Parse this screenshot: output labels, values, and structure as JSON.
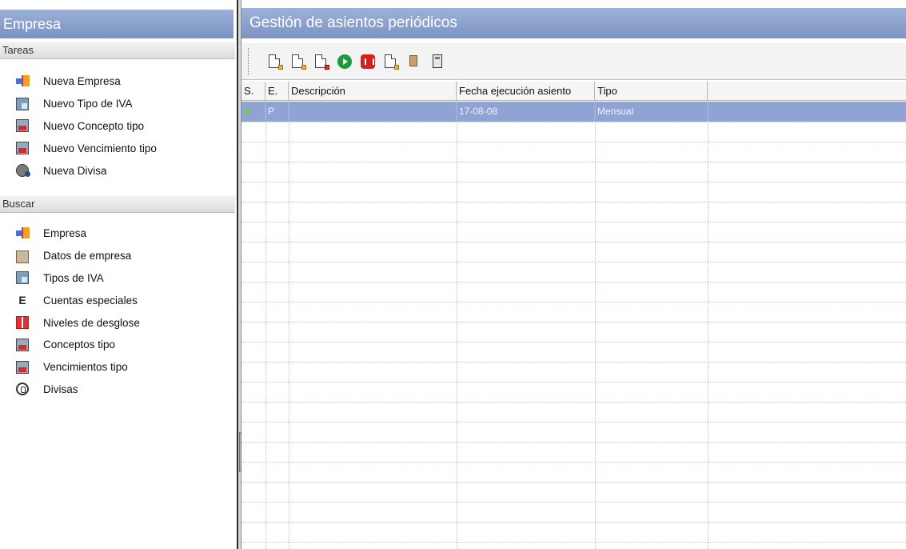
{
  "left": {
    "title": "Empresa",
    "tasks_header": "Tareas",
    "tasks": [
      {
        "label": "Nueva Empresa",
        "icon": "new-company-icon"
      },
      {
        "label": "Nuevo Tipo de IVA",
        "icon": "new-vat-type-icon"
      },
      {
        "label": "Nuevo Concepto tipo",
        "icon": "new-concept-icon"
      },
      {
        "label": "Nuevo Vencimiento tipo",
        "icon": "new-due-date-icon"
      },
      {
        "label": "Nueva Divisa",
        "icon": "new-currency-icon"
      }
    ],
    "search_header": "Buscar",
    "search": [
      {
        "label": "Empresa",
        "icon": "company-icon"
      },
      {
        "label": "Datos de empresa",
        "icon": "company-data-icon"
      },
      {
        "label": "Tipos de IVA",
        "icon": "vat-types-icon"
      },
      {
        "label": "Cuentas especiales",
        "icon": "special-accounts-icon"
      },
      {
        "label": "Niveles de desglose",
        "icon": "breakdown-levels-icon"
      },
      {
        "label": "Conceptos tipo",
        "icon": "concepts-icon"
      },
      {
        "label": "Vencimientos tipo",
        "icon": "due-dates-icon"
      },
      {
        "label": "Divisas",
        "icon": "currencies-icon"
      }
    ]
  },
  "main": {
    "title": "Gestión de asientos periódicos",
    "toolbar": [
      {
        "icon": "edit-document-icon"
      },
      {
        "icon": "document-icon"
      },
      {
        "icon": "document-search-icon"
      },
      {
        "icon": "play-icon"
      },
      {
        "icon": "pause-icon"
      },
      {
        "icon": "export-document-icon"
      },
      {
        "icon": "tools-icon"
      },
      {
        "icon": "calculator-icon"
      }
    ],
    "table": {
      "columns": [
        "S.",
        "E.",
        "Descripción",
        "Fecha ejecución asiento",
        "Tipo"
      ],
      "rows": [
        {
          "s": "",
          "e": "P",
          "descripcion": "",
          "fecha": "17-08-08",
          "tipo": "Mensual",
          "selected": true
        }
      ]
    }
  },
  "colors": {
    "header_bg": "#8aa0cc",
    "selection_bg": "#8fa4d4",
    "status_ok": "#7fc070"
  }
}
